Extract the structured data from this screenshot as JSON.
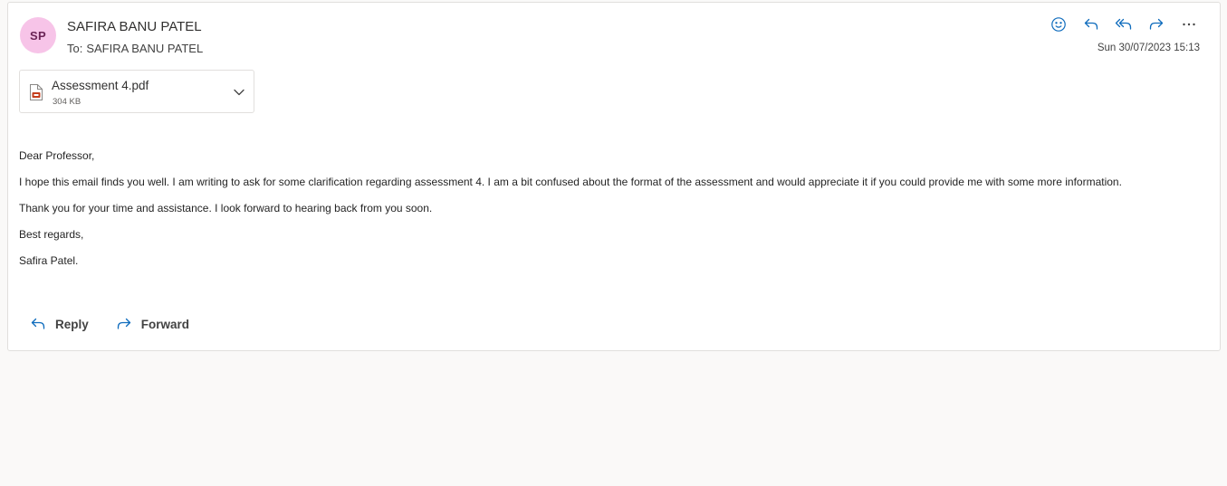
{
  "message": {
    "avatar_initials": "SP",
    "sender_name": "SAFIRA BANU PATEL",
    "to_label": "To:",
    "to_name": "SAFIRA BANU PATEL",
    "timestamp": "Sun 30/07/2023 15:13"
  },
  "toolbar": {
    "actions": [
      {
        "name": "emoji-react",
        "icon": "smiley-icon"
      },
      {
        "name": "reply",
        "icon": "reply-icon"
      },
      {
        "name": "reply-all",
        "icon": "reply-all-icon"
      },
      {
        "name": "forward",
        "icon": "forward-icon"
      },
      {
        "name": "more-actions",
        "icon": "ellipsis-icon"
      }
    ]
  },
  "attachment": {
    "file_name": "Assessment 4.pdf",
    "file_size": "304 KB",
    "icon": "pdf-file-icon"
  },
  "body": {
    "greeting": "Dear Professor,",
    "paragraph1": "I hope this email finds you well. I am writing to ask for some clarification regarding assessment 4. I am a bit confused about the format of the assessment and would appreciate it if you could provide me with some more information.",
    "paragraph2": "Thank you for your time and assistance. I look forward to hearing back from you soon.",
    "closing": "Best regards,",
    "signature": "Safira Patel."
  },
  "footer": {
    "reply_label": "Reply",
    "forward_label": "Forward"
  },
  "colors": {
    "avatar_bg": "#f7c4e8",
    "avatar_text": "#6b2456",
    "accent": "#0f6cbd",
    "pdf_red": "#c43e1c"
  }
}
